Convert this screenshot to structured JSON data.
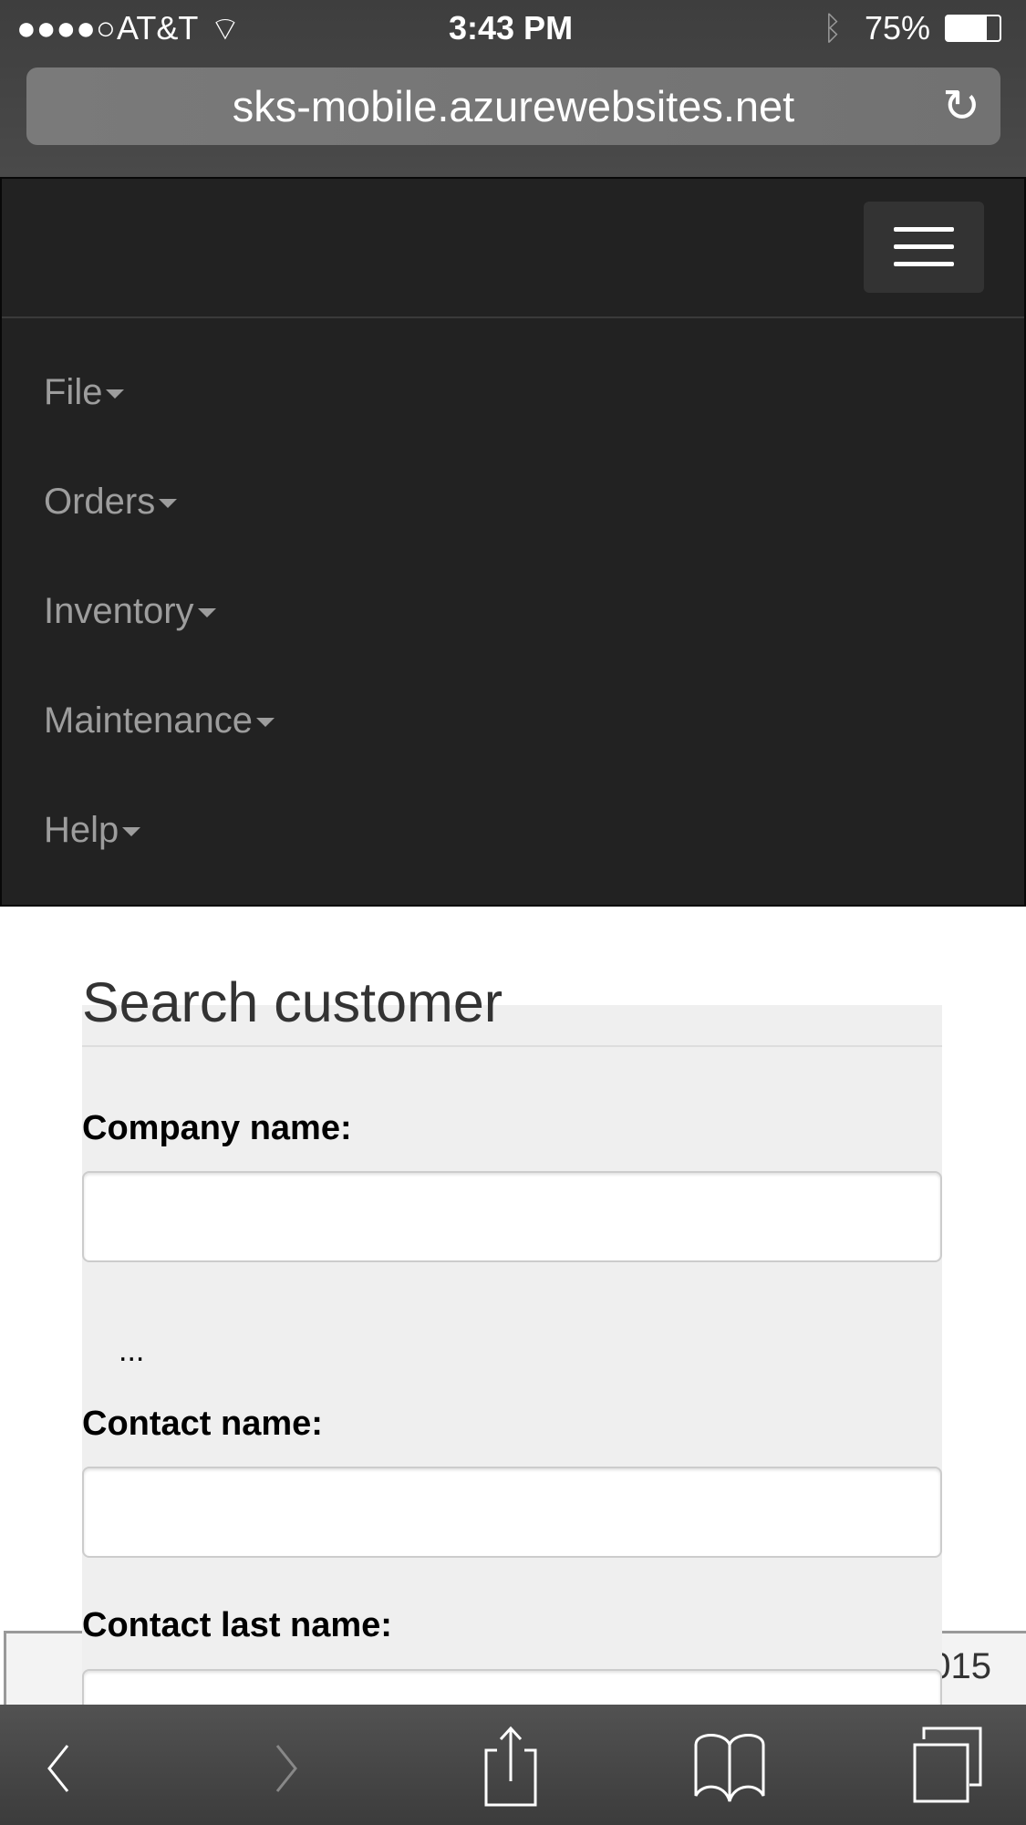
{
  "status_bar": {
    "carrier": "AT&T",
    "time": "3:43 PM",
    "battery": "75%",
    "signal_bars": 4,
    "battery_level": 0.75
  },
  "browser": {
    "url": "sks-mobile.azurewebsites.net"
  },
  "nav": {
    "items": [
      {
        "label": "File"
      },
      {
        "label": "Orders"
      },
      {
        "label": "Inventory"
      },
      {
        "label": "Maintenance"
      },
      {
        "label": "Help"
      }
    ]
  },
  "form": {
    "title": "Search customer",
    "company_label": "Company name:",
    "company_value": "",
    "ellipsis": "...",
    "contact_label": "Contact name:",
    "contact_value": "",
    "last_name_label": "Contact last name:",
    "last_name_value": ""
  },
  "footer": {
    "text": "015"
  }
}
